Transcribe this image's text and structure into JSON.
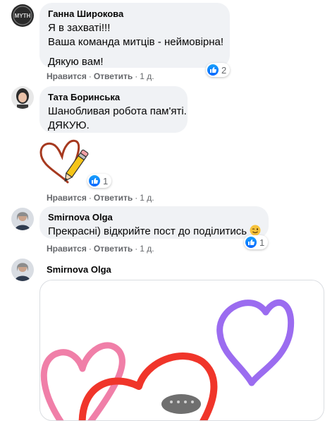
{
  "comments": [
    {
      "author": "Ганна Широкова",
      "lines": [
        "Я в захваті!!!",
        "Ваша команда митців - неймовірна!",
        "Дякую вам!"
      ],
      "actions": {
        "like": "Нравится",
        "reply": "Ответить",
        "time": "1 д."
      },
      "reaction_count": "2",
      "avatar_text": "MYTH"
    },
    {
      "author": "Тата Боринська",
      "lines": [
        "Шанобливая робота пам'яті.",
        "ДЯКУЮ."
      ],
      "actions": {
        "like": "Нравится",
        "reply": "Ответить",
        "time": "1 д."
      },
      "reaction_count": ""
    },
    {
      "sticker": "heart-pencil-sticker",
      "actions": {
        "like": "Нравится",
        "reply": "Ответить",
        "time": "1 д."
      },
      "reaction_count": "1"
    },
    {
      "author": "Smirnova Olga",
      "lines": [
        "Прекрасні) відкрийте пост до поділитись"
      ],
      "emoji": "winking-face-icon",
      "actions": {
        "like": "Нравится",
        "reply": "Ответить",
        "time": "1 д."
      },
      "reaction_count": "1"
    },
    {
      "author": "Smirnova Olga",
      "attachment": "hearts-image"
    }
  ],
  "colors": {
    "bubble": "#f0f2f5",
    "meta": "#65676b",
    "like_blue": "#0866ff",
    "heart_pink": "#f07fa8",
    "heart_red": "#f0352a",
    "heart_purple": "#9b6cf0"
  }
}
